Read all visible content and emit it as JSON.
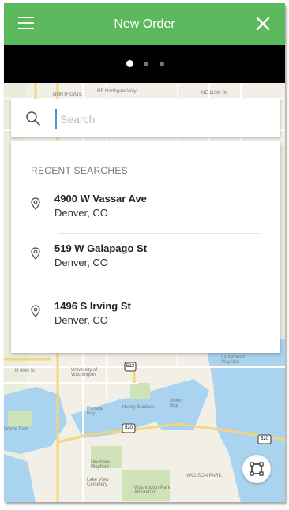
{
  "header": {
    "title": "New Order",
    "menu_icon": "hamburger-menu-icon",
    "close_icon": "close-icon"
  },
  "stepper": {
    "steps": 3,
    "active_step": 1
  },
  "search": {
    "placeholder": "Search",
    "value": ""
  },
  "recent": {
    "heading": "RECENT SEARCHES",
    "items": [
      {
        "street": "4900 W Vassar Ave",
        "city": "Denver, CO"
      },
      {
        "street": "519 W Galapago St",
        "city": "Denver, CO"
      },
      {
        "street": "1496 S Irving St",
        "city": "Denver, CO"
      }
    ]
  },
  "map": {
    "labels": {
      "northgate": "NORTHGATE",
      "northgate_way": "NE Northgate Way",
      "ne110": "NE 110th St",
      "n40": "N 40th St",
      "university": "University of Washington",
      "portage": "Portage Bay",
      "husky": "Husky Stadium",
      "union": "Union Bay",
      "works": "Works Park",
      "montlake": "Montlake Playfield",
      "madison": "MADISON PARK",
      "lakeview": "Lake View Cemetery",
      "arboretum": "Washington Park Arboretum",
      "laurelhurst": "Laurelhurst Playfield",
      "route_513": "513",
      "route_520a": "520",
      "route_520b": "520"
    },
    "fit_button_icon": "fit-bounds-icon"
  },
  "colors": {
    "header": "#5cb85c",
    "stepper_bg": "#000000",
    "water": "#aad3f0",
    "land": "#f2efe6"
  }
}
